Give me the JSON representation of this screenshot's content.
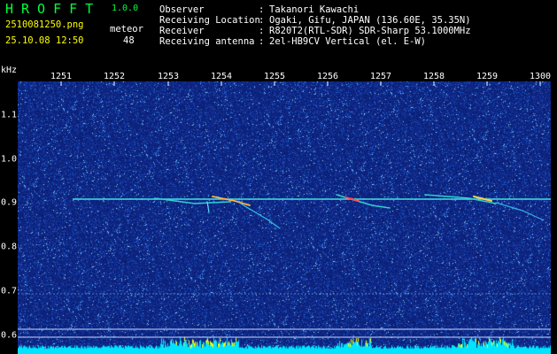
{
  "header": {
    "app_title": "HROFFT",
    "app_version": "1.0.0",
    "filename": "2510081250.png",
    "timestamp": "25.10.08 12:50",
    "meteor_label": "meteor",
    "meteor_count": "48"
  },
  "station": [
    {
      "label": "Observer",
      "value": "Takanori Kawachi"
    },
    {
      "label": "Receiving Location",
      "value": "Ogaki, Gifu, JAPAN (136.60E, 35.35N)"
    },
    {
      "label": "Receiver",
      "value": "R820T2(RTL-SDR) SDR-Sharp 53.1000MHz"
    },
    {
      "label": "Receiving antenna",
      "value": "2el-HB9CV Vertical (el. E-W)"
    }
  ],
  "colors": {
    "title_green": "#00ff3c",
    "accent_yellow": "#ffff00",
    "background_blue": "#0a1f7a",
    "bottom_power": "#00e5ff"
  },
  "axis": {
    "y_unit": "kHz",
    "x_ticks": [
      "1251",
      "1252",
      "1253",
      "1254",
      "1255",
      "1256",
      "1257",
      "1258",
      "1259",
      "1300"
    ],
    "y_ticks": [
      "1.1",
      "1.0",
      "0.9",
      "0.8",
      "0.7",
      "0.6"
    ]
  }
}
